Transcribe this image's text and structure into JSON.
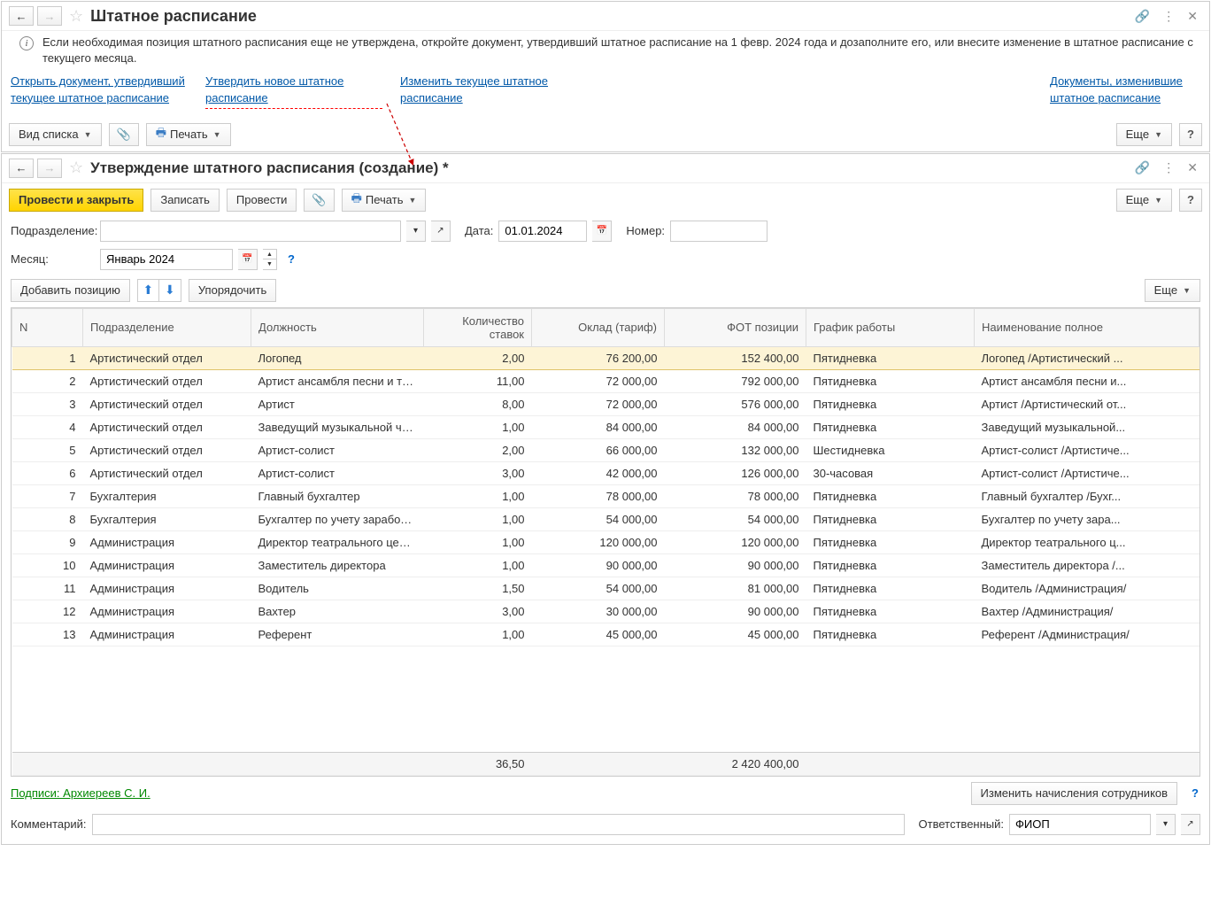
{
  "top": {
    "title": "Штатное расписание",
    "info": "Если необходимая позиция штатного расписания еще не утверждена, откройте документ, утвердивший штатное расписание на 1 февр. 2024 года и дозаполните его, или внесите изменение в штатное расписание с текущего месяца.",
    "link1": "Открыть документ, утвердивший текущее штатное расписание",
    "link2": "Утвердить новое штатное расписание",
    "link3": "Изменить текущее штатное расписание",
    "link4": "Документы, изменившие штатное расписание",
    "viewBtn": "Вид списка",
    "printBtn": "Печать",
    "more": "Еще"
  },
  "bottom": {
    "title": "Утверждение штатного расписания (создание) *",
    "postClose": "Провести и закрыть",
    "write": "Записать",
    "post": "Провести",
    "print": "Печать",
    "more": "Еще",
    "depLabel": "Подразделение:",
    "dateLabel": "Дата:",
    "dateVal": "01.01.2024",
    "numLabel": "Номер:",
    "monthLabel": "Месяц:",
    "monthVal": "Январь 2024",
    "addPos": "Добавить позицию",
    "order": "Упорядочить",
    "cols": {
      "n": "N",
      "dep": "Подразделение",
      "pos": "Должность",
      "cnt": "Количество ставок",
      "sal": "Оклад (тариф)",
      "fot": "ФОТ позиции",
      "sched": "График работы",
      "full": "Наименование полное"
    },
    "rows": [
      {
        "n": "1",
        "dep": "Артистический отдел",
        "pos": "Логопед",
        "cnt": "2,00",
        "sal": "76 200,00",
        "fot": "152 400,00",
        "sched": "Пятидневка",
        "full": "Логопед /Артистический ..."
      },
      {
        "n": "2",
        "dep": "Артистический отдел",
        "pos": "Артист ансамбля песни и танца",
        "cnt": "11,00",
        "sal": "72 000,00",
        "fot": "792 000,00",
        "sched": "Пятидневка",
        "full": "Артист ансамбля песни и..."
      },
      {
        "n": "3",
        "dep": "Артистический отдел",
        "pos": "Артист",
        "cnt": "8,00",
        "sal": "72 000,00",
        "fot": "576 000,00",
        "sched": "Пятидневка",
        "full": "Артист /Артистический от..."
      },
      {
        "n": "4",
        "dep": "Артистический отдел",
        "pos": "Заведущий музыкальной ча...",
        "cnt": "1,00",
        "sal": "84 000,00",
        "fot": "84 000,00",
        "sched": "Пятидневка",
        "full": "Заведущий музыкальной..."
      },
      {
        "n": "5",
        "dep": "Артистический отдел",
        "pos": "Артист-солист",
        "cnt": "2,00",
        "sal": "66 000,00",
        "fot": "132 000,00",
        "sched": "Шестидневка",
        "full": "Артист-солист /Артистиче..."
      },
      {
        "n": "6",
        "dep": "Артистический отдел",
        "pos": "Артист-солист",
        "cnt": "3,00",
        "sal": "42 000,00",
        "fot": "126 000,00",
        "sched": "30-часовая",
        "full": "Артист-солист /Артистиче..."
      },
      {
        "n": "7",
        "dep": "Бухгалтерия",
        "pos": "Главный бухгалтер",
        "cnt": "1,00",
        "sal": "78 000,00",
        "fot": "78 000,00",
        "sched": "Пятидневка",
        "full": "Главный бухгалтер /Бухг..."
      },
      {
        "n": "8",
        "dep": "Бухгалтерия",
        "pos": "Бухгалтер по учету заработн...",
        "cnt": "1,00",
        "sal": "54 000,00",
        "fot": "54 000,00",
        "sched": "Пятидневка",
        "full": "Бухгалтер по учету зара..."
      },
      {
        "n": "9",
        "dep": "Администрация",
        "pos": "Директор театрального центра",
        "cnt": "1,00",
        "sal": "120 000,00",
        "fot": "120 000,00",
        "sched": "Пятидневка",
        "full": "Директор театрального ц..."
      },
      {
        "n": "10",
        "dep": "Администрация",
        "pos": "Заместитель директора",
        "cnt": "1,00",
        "sal": "90 000,00",
        "fot": "90 000,00",
        "sched": "Пятидневка",
        "full": "Заместитель директора /..."
      },
      {
        "n": "11",
        "dep": "Администрация",
        "pos": "Водитель",
        "cnt": "1,50",
        "sal": "54 000,00",
        "fot": "81 000,00",
        "sched": "Пятидневка",
        "full": "Водитель /Администрация/"
      },
      {
        "n": "12",
        "dep": "Администрация",
        "pos": "Вахтер",
        "cnt": "3,00",
        "sal": "30 000,00",
        "fot": "90 000,00",
        "sched": "Пятидневка",
        "full": "Вахтер /Администрация/"
      },
      {
        "n": "13",
        "dep": "Администрация",
        "pos": "Референт",
        "cnt": "1,00",
        "sal": "45 000,00",
        "fot": "45 000,00",
        "sched": "Пятидневка",
        "full": "Референт /Администрация/"
      }
    ],
    "totals": {
      "cnt": "36,50",
      "fot": "2 420 400,00"
    },
    "sig": "Подписи: Архиереев С. И.",
    "changeBtn": "Изменить начисления сотрудников",
    "commentLabel": "Комментарий:",
    "respLabel": "Ответственный:",
    "respVal": "ФИОП"
  }
}
